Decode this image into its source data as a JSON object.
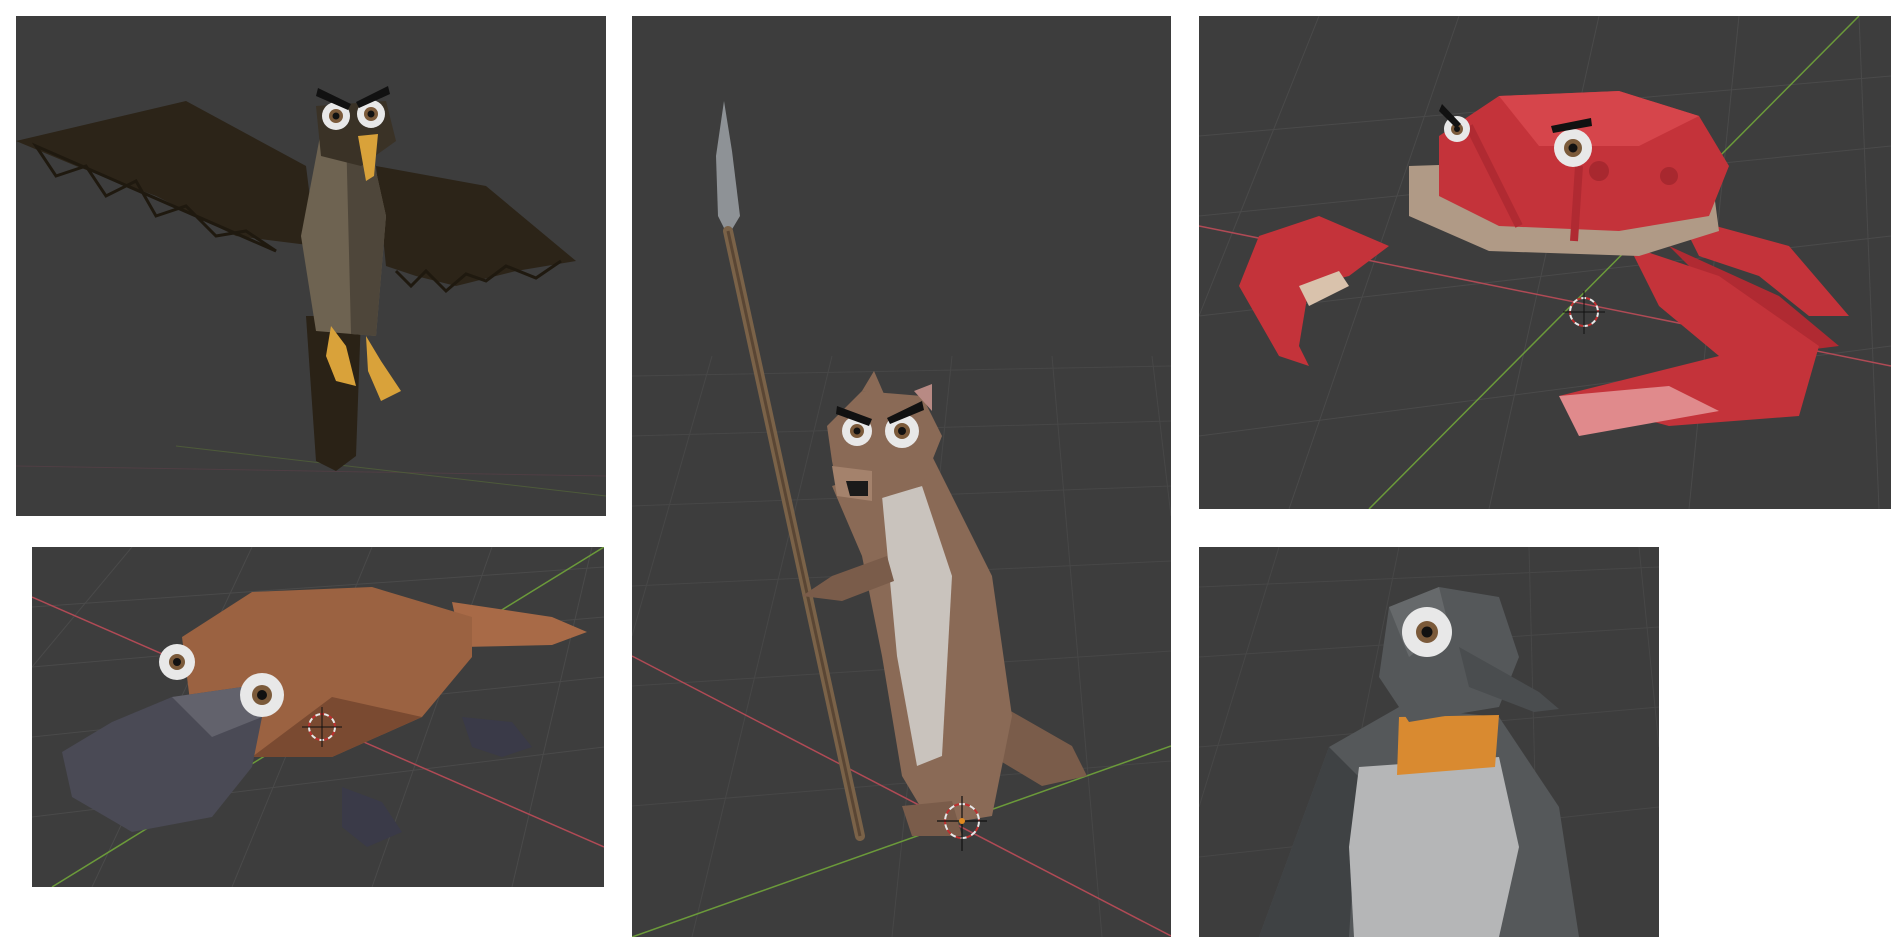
{
  "colors": {
    "viewport_bg": "#3d3d3d",
    "grid_line": "#4a4a4a",
    "x_axis": "#b04a55",
    "y_axis": "#6b9a3a",
    "eagle_feathers": "#2c2418",
    "eagle_body": "#6e6351",
    "eagle_beak": "#d9a23a",
    "platypus_fur": "#9b6241",
    "platypus_bill": "#4a4a55",
    "otter_fur": "#8a6a56",
    "otter_belly": "#c9c3bd",
    "spear_shaft": "#7a6248",
    "spear_tip": "#8e9296",
    "crab_shell": "#c4333a",
    "crab_under": "#b09a86",
    "penguin_body": "#55585a",
    "penguin_belly": "#b5b6b7",
    "penguin_collar": "#d98a30"
  },
  "panels": [
    {
      "id": "eagle",
      "subject": "eagle-model"
    },
    {
      "id": "platypus",
      "subject": "platypus-model"
    },
    {
      "id": "otter",
      "subject": "otter-with-spear-model"
    },
    {
      "id": "crab",
      "subject": "crab-model"
    },
    {
      "id": "penguin",
      "subject": "penguin-model"
    }
  ]
}
